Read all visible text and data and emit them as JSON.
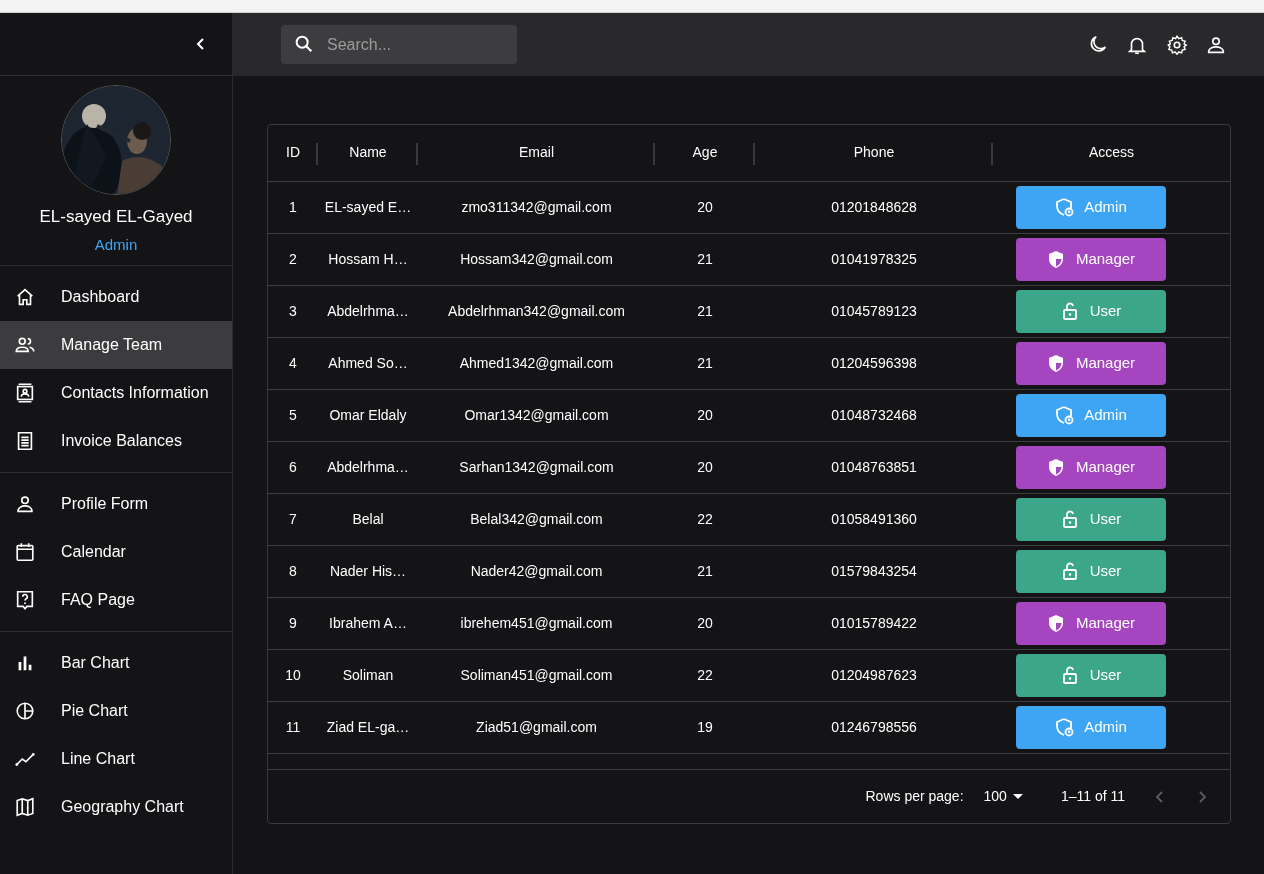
{
  "sidebar": {
    "profile": {
      "name": "EL-sayed EL-Gayed",
      "role": "Admin"
    },
    "groups": [
      {
        "items": [
          {
            "label": "Dashboard",
            "selected": false
          },
          {
            "label": "Manage Team",
            "selected": true
          },
          {
            "label": "Contacts Information",
            "selected": false
          },
          {
            "label": "Invoice Balances",
            "selected": false
          }
        ]
      },
      {
        "items": [
          {
            "label": "Profile Form",
            "selected": false
          },
          {
            "label": "Calendar",
            "selected": false
          },
          {
            "label": "FAQ Page",
            "selected": false
          }
        ]
      },
      {
        "items": [
          {
            "label": "Bar Chart",
            "selected": false
          },
          {
            "label": "Pie Chart",
            "selected": false
          },
          {
            "label": "Line Chart",
            "selected": false
          },
          {
            "label": "Geography Chart",
            "selected": false
          }
        ]
      }
    ]
  },
  "topbar": {
    "search": {
      "placeholder": "Search..."
    }
  },
  "table": {
    "columns": [
      "ID",
      "Name",
      "Email",
      "Age",
      "Phone",
      "Access"
    ],
    "rows": [
      {
        "id": "1",
        "name": "EL-sayed E…",
        "email": "zmo311342@gmail.com",
        "age": "20",
        "phone": "01201848628",
        "access": {
          "label": "Admin",
          "kind": "admin",
          "color": "#3da5f4"
        }
      },
      {
        "id": "2",
        "name": "Hossam H…",
        "email": "Hossam342@gmail.com",
        "age": "21",
        "phone": "01041978325",
        "access": {
          "label": "Manager",
          "kind": "manager",
          "color": "#a545c0"
        }
      },
      {
        "id": "3",
        "name": "Abdelrhma…",
        "email": "Abdelrhman342@gmail.com",
        "age": "21",
        "phone": "01045789123",
        "access": {
          "label": "User",
          "kind": "user",
          "color": "#3ba68a"
        }
      },
      {
        "id": "4",
        "name": "Ahmed So…",
        "email": "Ahmed1342@gmail.com",
        "age": "21",
        "phone": "01204596398",
        "access": {
          "label": "Manager",
          "kind": "manager",
          "color": "#a545c0"
        }
      },
      {
        "id": "5",
        "name": "Omar Eldaly",
        "email": "Omar1342@gmail.com",
        "age": "20",
        "phone": "01048732468",
        "access": {
          "label": "Admin",
          "kind": "admin",
          "color": "#3da5f4"
        }
      },
      {
        "id": "6",
        "name": "Abdelrhma…",
        "email": "Sarhan1342@gmail.com",
        "age": "20",
        "phone": "01048763851",
        "access": {
          "label": "Manager",
          "kind": "manager",
          "color": "#a545c0"
        }
      },
      {
        "id": "7",
        "name": "Belal",
        "email": "Belal342@gmail.com",
        "age": "22",
        "phone": "01058491360",
        "access": {
          "label": "User",
          "kind": "user",
          "color": "#3ba68a"
        }
      },
      {
        "id": "8",
        "name": "Nader His…",
        "email": "Nader42@gmail.com",
        "age": "21",
        "phone": "01579843254",
        "access": {
          "label": "User",
          "kind": "user",
          "color": "#3ba68a"
        }
      },
      {
        "id": "9",
        "name": "Ibrahem A…",
        "email": "ibrehem451@gmail.com",
        "age": "20",
        "phone": "01015789422",
        "access": {
          "label": "Manager",
          "kind": "manager",
          "color": "#a545c0"
        }
      },
      {
        "id": "10",
        "name": "Soliman",
        "email": "Soliman451@gmail.com",
        "age": "22",
        "phone": "01204987623",
        "access": {
          "label": "User",
          "kind": "user",
          "color": "#3ba68a"
        }
      },
      {
        "id": "11",
        "name": "Ziad EL-ga…",
        "email": "Ziad51@gmail.com",
        "age": "19",
        "phone": "01246798556",
        "access": {
          "label": "Admin",
          "kind": "admin",
          "color": "#3da5f4"
        }
      }
    ],
    "footer": {
      "rows_per_page_label": "Rows per page:",
      "rows_per_page": "100",
      "range": "1–11 of 11",
      "prev_disabled": true,
      "next_disabled": true
    }
  }
}
